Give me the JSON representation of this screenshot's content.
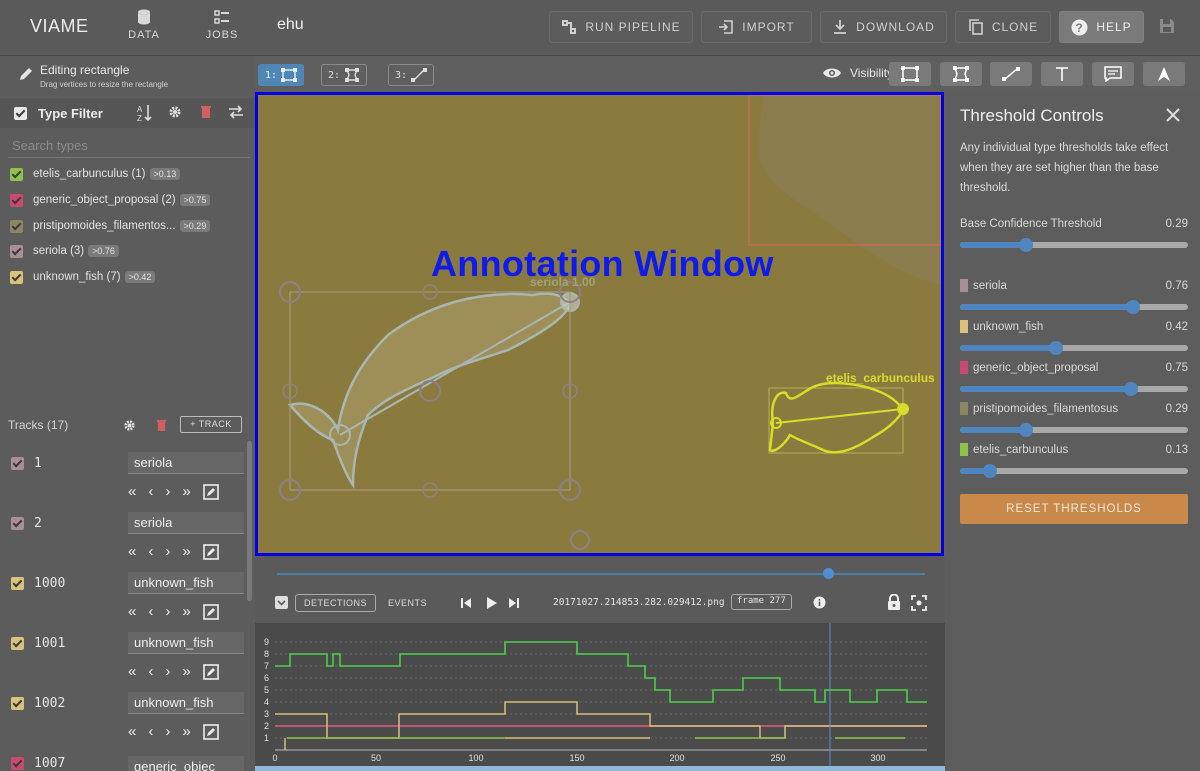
{
  "app": {
    "brand": "VIAME",
    "nav": [
      {
        "label": "DATA"
      },
      {
        "label": "JOBS"
      }
    ],
    "title": "ehu"
  },
  "toolbar": {
    "run_pipeline": "RUN PIPELINE",
    "import": "IMPORT",
    "download": "DOWNLOAD",
    "clone": "CLONE",
    "help": "HELP"
  },
  "edit_mode": {
    "title": "Editing rectangle",
    "subtitle": "Drag vertices to resize the rectangle"
  },
  "type_filter": {
    "title": "Type Filter",
    "search_placeholder": "Search types",
    "types": [
      {
        "label": "etelis_carbunculus (1)",
        "threshold": ">0.13",
        "color": "#8fc24a"
      },
      {
        "label": "generic_object_proposal (2)",
        "threshold": ">0.75",
        "color": "#c94a6e"
      },
      {
        "label": "pristipomoides_filamentos...",
        "threshold": ">0.29",
        "color": "#8d8661"
      },
      {
        "label": "seriola (3)",
        "threshold": ">0.76",
        "color": "#a98e95"
      },
      {
        "label": "unknown_fish (7)",
        "threshold": ">0.42",
        "color": "#d8c27c"
      }
    ]
  },
  "tracks": {
    "title": "Tracks (17)",
    "add_label": "TRACK",
    "items": [
      {
        "id": "1",
        "type": "seriola",
        "color": "#a98e95"
      },
      {
        "id": "2",
        "type": "seriola",
        "color": "#a98e95"
      },
      {
        "id": "1000",
        "type": "unknown_fish",
        "color": "#d8c27c"
      },
      {
        "id": "1001",
        "type": "unknown_fish",
        "color": "#d8c27c"
      },
      {
        "id": "1002",
        "type": "unknown_fish",
        "color": "#d8c27c"
      },
      {
        "id": "1007",
        "type": "generic_objec",
        "color": "#c94a6e"
      }
    ],
    "controls": [
      "«",
      "‹",
      "›",
      "»"
    ]
  },
  "modes": [
    {
      "key": "1:",
      "active": true
    },
    {
      "key": "2:",
      "active": false
    },
    {
      "key": "3:",
      "active": false
    }
  ],
  "visibility_label": "Visibility",
  "canvas": {
    "overlay_label": "Annotation Window",
    "detections": [
      {
        "label": "seriola 1.00"
      },
      {
        "label": "etelis_carbunculus"
      }
    ]
  },
  "timeline": {
    "detections_btn": "DETECTIONS",
    "events_btn": "EVENTS",
    "filename": "20171027.214853.282.029412.png",
    "frame": "frame 277",
    "y_ticks": [
      "1",
      "2",
      "3",
      "4",
      "5",
      "6",
      "7",
      "8",
      "9"
    ],
    "x_ticks": [
      "0",
      "50",
      "100",
      "150",
      "200",
      "250",
      "300"
    ]
  },
  "threshold_controls": {
    "title": "Threshold Controls",
    "description": "Any individual type thresholds take effect when they are set higher than the base threshold.",
    "base": {
      "label": "Base Confidence Threshold",
      "value": "0.29",
      "fraction": 0.29
    },
    "types": [
      {
        "label": "seriola",
        "value": "0.76",
        "fraction": 0.76,
        "color": "#a98e95"
      },
      {
        "label": "unknown_fish",
        "value": "0.42",
        "fraction": 0.42,
        "color": "#d8c27c"
      },
      {
        "label": "generic_object_proposal",
        "value": "0.75",
        "fraction": 0.75,
        "color": "#c94a6e"
      },
      {
        "label": "pristipomoides_filamentosus",
        "value": "0.29",
        "fraction": 0.29,
        "color": "#8d8661"
      },
      {
        "label": "etelis_carbunculus",
        "value": "0.13",
        "fraction": 0.13,
        "color": "#8fc24a"
      }
    ],
    "reset_label": "RESET THRESHOLDS"
  }
}
